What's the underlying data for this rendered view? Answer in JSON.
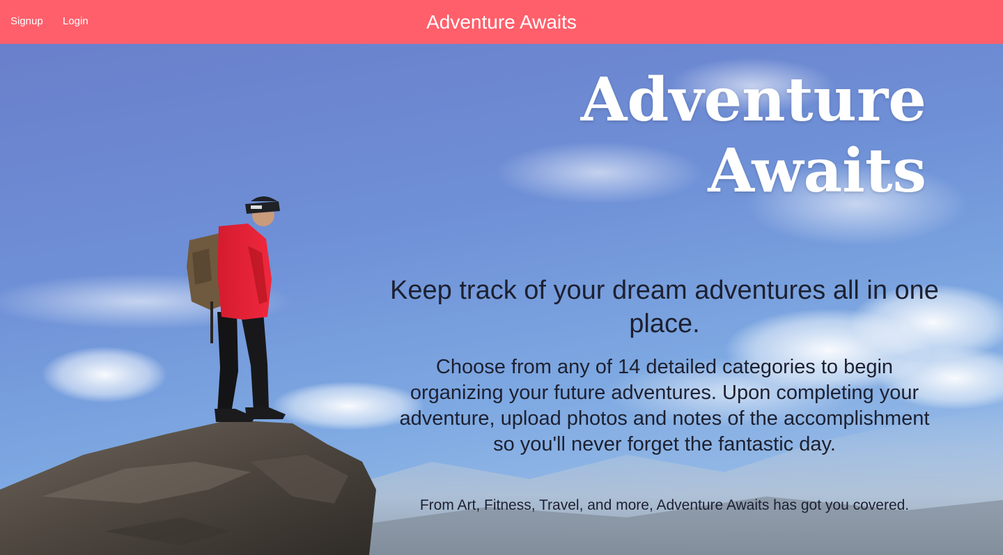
{
  "navbar": {
    "signup_label": "Signup",
    "login_label": "Login",
    "brand": "Adventure Awaits",
    "background_color": "#ff5f6b"
  },
  "hero": {
    "title_line1": "Adventure",
    "title_line2": "Awaits",
    "tagline": "Keep track of your dream adventures all in one place.",
    "description": "Choose from any of 14 detailed categories to begin organizing your future adventures. Upon completing your adventure, upload photos and notes of the accomplishment so you'll never forget the fantastic day.",
    "footer_text": "From Art, Fitness, Travel, and more, Adventure Awaits has got you covered.",
    "background_image": "hiker-on-rock-cliff-photo"
  }
}
